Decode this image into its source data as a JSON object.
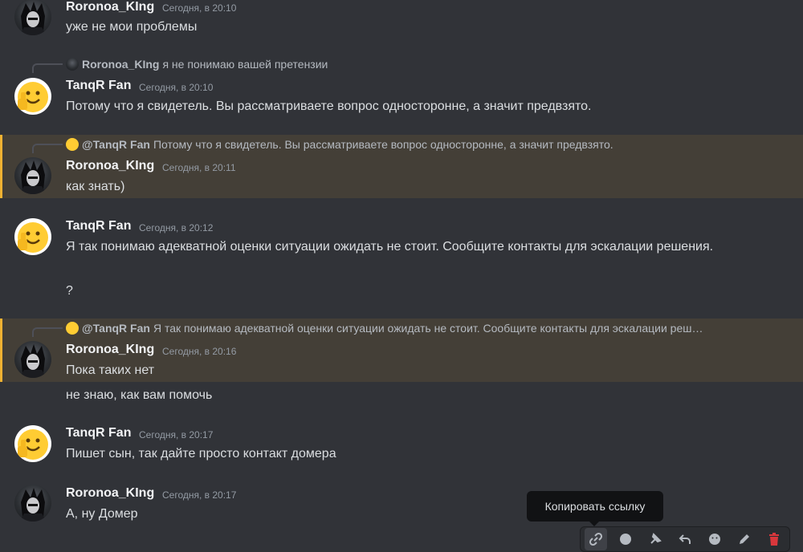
{
  "messages": [
    {
      "author": "Roronoa_KIng",
      "time": "Сегодня, в 20:10",
      "text": "уже не мои проблемы"
    },
    {
      "author": "TanqR Fan",
      "time": "Сегодня, в 20:10",
      "reply": {
        "author": "Roronoa_KIng",
        "text": "я не понимаю вашей претензии"
      },
      "text": "Потому что я свидетель. Вы рассматриваете вопрос односторонне, а значит предвзято."
    },
    {
      "author": "Roronoa_KIng",
      "time": "Сегодня, в 20:11",
      "reply": {
        "author": "@TanqR Fan",
        "text": "Потому что я свидетель. Вы рассматриваете вопрос односторонне, а значит предвзято."
      },
      "text": "как знать)"
    },
    {
      "author": "TanqR Fan",
      "time": "Сегодня, в 20:12",
      "text": "Я так понимаю адекватной оценки ситуации ожидать не стоит. Сообщите контакты для эскалации решения.",
      "followup": "?"
    },
    {
      "author": "Roronoa_KIng",
      "time": "Сегодня, в 20:16",
      "reply": {
        "author": "@TanqR Fan",
        "text": "Я так понимаю адекватной оценки ситуации ожидать не стоит. Сообщите контакты для эскалации реш…"
      },
      "text": "Пока таких нет",
      "followup": "не знаю, как вам помочь"
    },
    {
      "author": "TanqR Fan",
      "time": "Сегодня, в 20:17",
      "text": "Пишет сын, так дайте просто контакт домера"
    },
    {
      "author": "Roronoa_KIng",
      "time": "Сегодня, в 20:17",
      "text": "А, ну Домер"
    }
  ],
  "tooltip": {
    "text": "Копировать ссылку"
  },
  "toolbar": {
    "icons": [
      "link-icon",
      "emoji-icon",
      "pin-icon",
      "reply-icon",
      "smile-icon",
      "edit-icon",
      "trash-icon"
    ]
  },
  "colors": {
    "mention_bar": "#f0b232",
    "delete": "#da373c",
    "background": "#313338"
  }
}
